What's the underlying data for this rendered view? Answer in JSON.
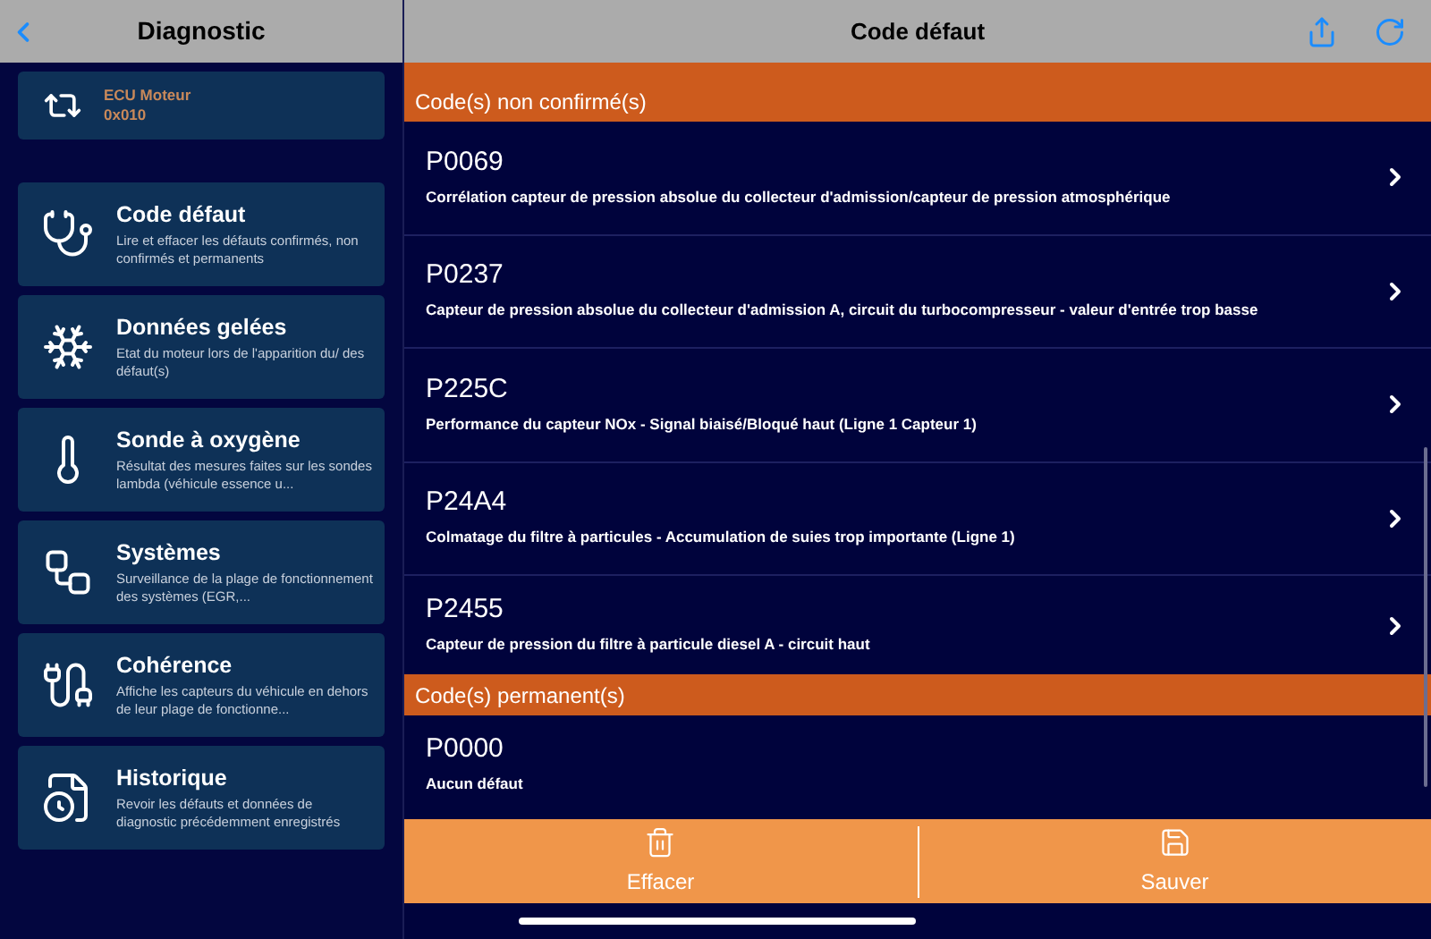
{
  "sidebar": {
    "title": "Diagnostic",
    "ecu": {
      "name": "ECU Moteur",
      "address": "0x010"
    },
    "items": [
      {
        "title": "Code défaut",
        "description": "Lire et effacer les défauts confirmés, non confirmés et permanents"
      },
      {
        "title": "Données gelées",
        "description": "Etat du moteur lors de l'apparition du/ des défaut(s)"
      },
      {
        "title": "Sonde à oxygène",
        "description": "Résultat des mesures faites sur les sondes lambda (véhicule essence u..."
      },
      {
        "title": "Systèmes",
        "description": "Surveillance de la plage de fonctionnement des systèmes (EGR,..."
      },
      {
        "title": "Cohérence",
        "description": "Affiche les capteurs du véhicule en dehors de leur plage de fonctionne..."
      },
      {
        "title": "Historique",
        "description": "Revoir les défauts et données de diagnostic précédemment enregistrés"
      }
    ]
  },
  "main": {
    "title": "Code défaut",
    "sections": [
      {
        "title": "Code(s) non confirmé(s)",
        "codes": [
          {
            "code": "P0069",
            "description": "Corrélation capteur de pression absolue du collecteur d'admission/capteur de pression atmosphérique",
            "chevron": true
          },
          {
            "code": "P0237",
            "description": "Capteur de pression absolue du collecteur d'admission A, circuit du turbocompresseur - valeur d'entrée trop basse",
            "chevron": true
          },
          {
            "code": "P225C",
            "description": "Performance du capteur NOx - Signal biaisé/Bloqué haut (Ligne 1 Capteur 1)",
            "chevron": true
          },
          {
            "code": "P24A4",
            "description": "Colmatage du filtre à particules - Accumulation de suies trop importante (Ligne 1)",
            "chevron": true
          },
          {
            "code": "P2455",
            "description": "Capteur de pression du filtre à particule diesel A - circuit haut",
            "chevron": true
          }
        ]
      },
      {
        "title": "Code(s) permanent(s)",
        "codes": [
          {
            "code": "P0000",
            "description": "Aucun défaut",
            "chevron": false
          }
        ]
      }
    ],
    "actions": [
      "Effacer",
      "Sauver"
    ]
  }
}
